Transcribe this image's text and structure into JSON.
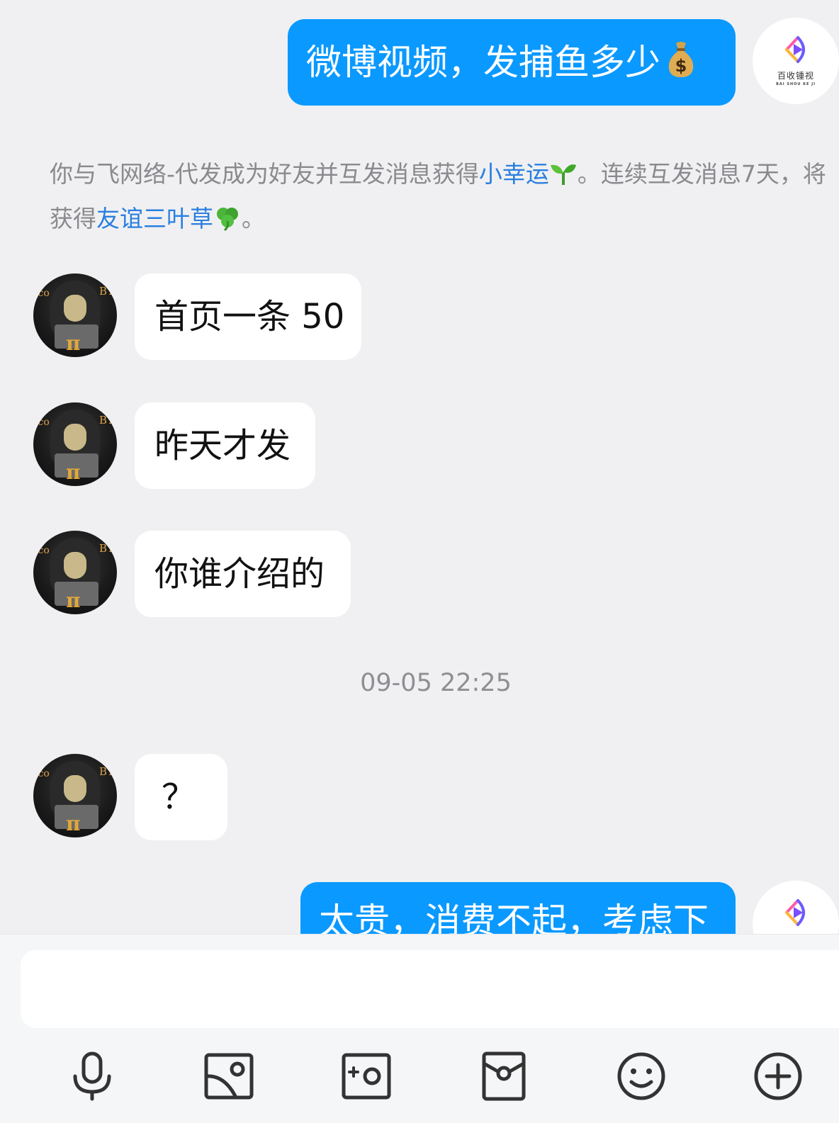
{
  "messages": {
    "out_1": {
      "text": "微博视频，发捕鱼多少",
      "emoji": "money-bag"
    },
    "system": {
      "part1": "你与飞网络-代发成为好友并互发消息获得",
      "link1": "小幸运",
      "part2": "。连续互发消息7天，将获得",
      "link2": "友谊三叶草",
      "part3": "。"
    },
    "in_1": "首页一条 50",
    "in_2": "昨天才发",
    "in_3": "你谁介绍的",
    "timestamp": "09-05 22:25",
    "in_4": "？",
    "out_2": "太贵，消费不起，考虑下"
  },
  "self_avatar": {
    "brand": "百收锺视",
    "brand_sub": "BAI SHOU KE JI"
  },
  "contact_avatar": {
    "left_text": "ico",
    "right_text": "BT",
    "symbol": "π"
  },
  "toolbar": {
    "icons": [
      "microphone-icon",
      "photo-icon",
      "camera-icon",
      "red-packet-icon",
      "emoji-icon",
      "plus-icon"
    ]
  },
  "colors": {
    "outgoing_bubble": "#0a99ff",
    "incoming_bubble": "#ffffff",
    "link": "#2a7fe0",
    "background": "#f0f0f2"
  }
}
